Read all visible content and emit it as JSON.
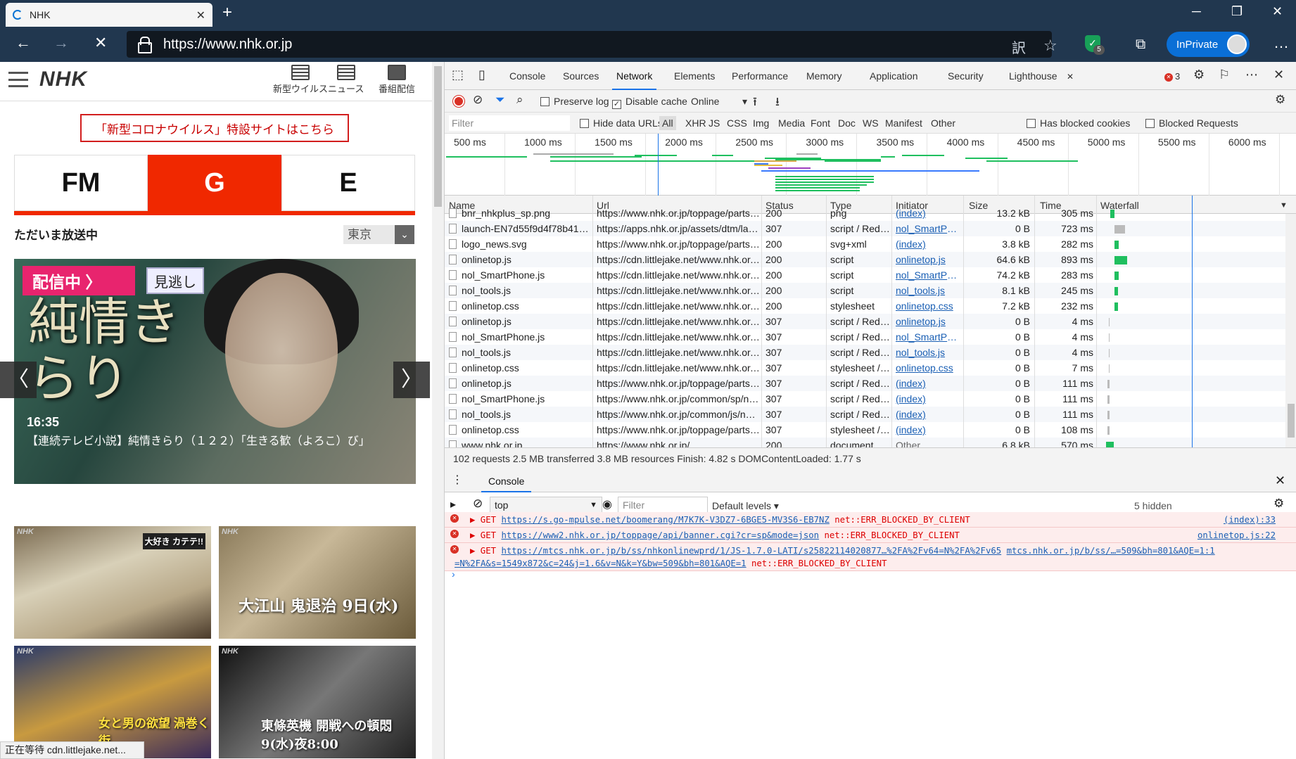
{
  "browser": {
    "tab_title": "NHK",
    "tab_close": "✕",
    "new_tab": "+",
    "url": "https://www.nhk.or.jp",
    "inprivate": "InPrivate",
    "shield_count": "5",
    "win_min": "─",
    "win_max": "❐",
    "win_close": "✕",
    "back": "←",
    "forward": "→",
    "stop": "✕",
    "more": "…",
    "translate": "訳",
    "fav": "☆",
    "collections": "⧉"
  },
  "page": {
    "logo": "NHK",
    "header_icons": [
      {
        "label": "新型ウイルス"
      },
      {
        "label": "ニュース"
      },
      {
        "label": "番組配信"
      }
    ],
    "banner": "「新型コロナウイルス」特設サイトはこちら",
    "channels": [
      "FM",
      "G",
      "E"
    ],
    "on_air": "ただいま放送中",
    "region": "東京",
    "region_dd": "⌄",
    "hero": {
      "live_badge": "配信中 〉",
      "rewatch": "見逃し",
      "title_art": "純情きらり",
      "time": "16:35",
      "desc": "【連続テレビ小説】純情きらり（１２２）「生きる歓（よろこ）び」",
      "prev": "〈",
      "next": "〉"
    },
    "thumbs": [
      {
        "brand": "NHK",
        "caption": "大好き カテテ!!"
      },
      {
        "brand": "NHK",
        "caption": "大江山 鬼退治 9日(水)"
      },
      {
        "brand": "NHK",
        "caption": "女と男の欲望 渦巻く街"
      },
      {
        "brand": "NHK",
        "caption": "東條英機 開戦への頓悶 9(水)夜8:00"
      }
    ],
    "status": "正在等待 cdn.littlejake.net..."
  },
  "devtools": {
    "tabs": [
      "Console",
      "Sources",
      "Network",
      "Elements",
      "Performance",
      "Memory",
      "Application",
      "Security",
      "Lighthouse"
    ],
    "active_tab": "Network",
    "lighthouse_close": "✕",
    "error_count": "3",
    "icons": {
      "inspect": "⬚",
      "device": "▯",
      "settings": "⚙",
      "feedback": "⚐",
      "more": "⋯",
      "close": "✕"
    },
    "toolbar": {
      "clear": "⊘",
      "filter": "⏷",
      "search": "⌕",
      "preserve_log": "Preserve log",
      "disable_cache": "Disable cache",
      "throttle": "Online",
      "throttle_dd": "▾",
      "import": "⭱",
      "export": "⭳",
      "settings": "⚙",
      "checkmark": "✓"
    },
    "filter": {
      "placeholder": "Filter",
      "hide_data_urls": "Hide data URLs",
      "types": [
        "All",
        "XHR",
        "JS",
        "CSS",
        "Img",
        "Media",
        "Font",
        "Doc",
        "WS",
        "Manifest",
        "Other"
      ],
      "has_blocked_cookies": "Has blocked cookies",
      "blocked_requests": "Blocked Requests"
    },
    "timeline_ticks": [
      "500 ms",
      "1000 ms",
      "1500 ms",
      "2000 ms",
      "2500 ms",
      "3000 ms",
      "3500 ms",
      "4000 ms",
      "4500 ms",
      "5000 ms",
      "5500 ms",
      "6000 ms"
    ],
    "columns": [
      "Name",
      "Url",
      "Status",
      "Type",
      "Initiator",
      "Size",
      "Time",
      "Waterfall"
    ],
    "waterfall_dd": "▼",
    "rows": [
      {
        "name": "bnr_nhkplus_sp.png",
        "url": "https://www.nhk.or.jp/toppage/parts/i...",
        "status": "200",
        "type": "png",
        "initiator": "(index)",
        "size": "13.2 kB",
        "time": "305 ms",
        "link": true
      },
      {
        "name": "launch-EN7d55f9d4f78b41259...",
        "url": "https://apps.nhk.or.jp/assets/dtm/launc...",
        "status": "307",
        "type": "script / Redir...",
        "initiator": "nol_SmartPho...",
        "size": "0 B",
        "time": "723 ms",
        "link": true
      },
      {
        "name": "logo_news.svg",
        "url": "https://www.nhk.or.jp/toppage/parts/i...",
        "status": "200",
        "type": "svg+xml",
        "initiator": "(index)",
        "size": "3.8 kB",
        "time": "282 ms",
        "link": true
      },
      {
        "name": "onlinetop.js",
        "url": "https://cdn.littlejake.net/www.nhk.or.jp/...",
        "status": "200",
        "type": "script",
        "initiator": "onlinetop.js",
        "size": "64.6 kB",
        "time": "893 ms",
        "link": true
      },
      {
        "name": "nol_SmartPhone.js",
        "url": "https://cdn.littlejake.net/www.nhk.or.jp/...",
        "status": "200",
        "type": "script",
        "initiator": "nol_SmartPho...",
        "size": "74.2 kB",
        "time": "283 ms",
        "link": true
      },
      {
        "name": "nol_tools.js",
        "url": "https://cdn.littlejake.net/www.nhk.or.jp/...",
        "status": "200",
        "type": "script",
        "initiator": "nol_tools.js",
        "size": "8.1 kB",
        "time": "245 ms",
        "link": true
      },
      {
        "name": "onlinetop.css",
        "url": "https://cdn.littlejake.net/www.nhk.or.jp/...",
        "status": "200",
        "type": "stylesheet",
        "initiator": "onlinetop.css",
        "size": "7.2 kB",
        "time": "232 ms",
        "link": true
      },
      {
        "name": "onlinetop.js",
        "url": "https://cdn.littlejake.net/www.nhk.or.jp/...",
        "status": "307",
        "type": "script / Redir...",
        "initiator": "onlinetop.js",
        "size": "0 B",
        "time": "4 ms",
        "link": true
      },
      {
        "name": "nol_SmartPhone.js",
        "url": "https://cdn.littlejake.net/www.nhk.or.jp/...",
        "status": "307",
        "type": "script / Redir...",
        "initiator": "nol_SmartPho...",
        "size": "0 B",
        "time": "4 ms",
        "link": true
      },
      {
        "name": "nol_tools.js",
        "url": "https://cdn.littlejake.net/www.nhk.or.jp/...",
        "status": "307",
        "type": "script / Redir...",
        "initiator": "nol_tools.js",
        "size": "0 B",
        "time": "4 ms",
        "link": true
      },
      {
        "name": "onlinetop.css",
        "url": "https://cdn.littlejake.net/www.nhk.or.jp/...",
        "status": "307",
        "type": "stylesheet / ...",
        "initiator": "onlinetop.css",
        "size": "0 B",
        "time": "7 ms",
        "link": true
      },
      {
        "name": "onlinetop.js",
        "url": "https://www.nhk.or.jp/toppage/parts/js...",
        "status": "307",
        "type": "script / Redir...",
        "initiator": "(index)",
        "size": "0 B",
        "time": "111 ms",
        "link": true
      },
      {
        "name": "nol_SmartPhone.js",
        "url": "https://www.nhk.or.jp/common/sp/nol_...",
        "status": "307",
        "type": "script / Redir...",
        "initiator": "(index)",
        "size": "0 B",
        "time": "111 ms",
        "link": true
      },
      {
        "name": "nol_tools.js",
        "url": "https://www.nhk.or.jp/common/js/nol_t...",
        "status": "307",
        "type": "script / Redir...",
        "initiator": "(index)",
        "size": "0 B",
        "time": "111 ms",
        "link": true
      },
      {
        "name": "onlinetop.css",
        "url": "https://www.nhk.or.jp/toppage/parts/cs...",
        "status": "307",
        "type": "stylesheet / ...",
        "initiator": "(index)",
        "size": "0 B",
        "time": "108 ms",
        "link": true
      },
      {
        "name": "www.nhk.or.jp",
        "url": "https://www.nhk.or.jp/",
        "status": "200",
        "type": "document",
        "initiator": "Other",
        "size": "6.8 kB",
        "time": "570 ms",
        "link": false
      }
    ],
    "summary": "102 requests  2.5 MB transferred  3.8 MB resources  Finish: 4.82 s  DOMContentLoaded: 1.77 s",
    "drawer": {
      "more": "⋮",
      "tab": "Console",
      "close": "✕",
      "context": "top",
      "context_dd": "▼",
      "filter_placeholder": "Filter",
      "levels": "Default levels ▾",
      "hidden": "5 hidden",
      "prompt": "›",
      "sidebar": "▸",
      "clear": "⊘",
      "eye": "◉",
      "settings": "⚙",
      "err_icon": "✕",
      "logs": [
        {
          "method": "▶ GET",
          "url": "https://s.go-mpulse.net/boomerang/M7K7K-V3DZ7-6BGE5-MV3S6-EB7NZ",
          "err": "net::ERR_BLOCKED_BY_CLIENT",
          "src": "(index):33"
        },
        {
          "method": "▶ GET",
          "url": "https://www2.nhk.or.jp/toppage/api/banner.cgi?cr=sp&mode=json",
          "err": "net::ERR_BLOCKED_BY_CLIENT",
          "src": "onlinetop.js:22"
        },
        {
          "method": "▶ GET",
          "url": "https://mtcs.nhk.or.jp/b/ss/nhkonlinewprd/1/JS-1.7.0-LATI/s25822114020877…%2FA%2Fv64=N%2FA%2Fv65",
          "url2": "mtcs.nhk.or.jp/b/ss/…=509&bh=801&AQE=1:1",
          "url3": "=N%2FA&s=1549x872&c=24&j=1.6&v=N&k=Y&bw=509&bh=801&AQE=1",
          "err": "net::ERR_BLOCKED_BY_CLIENT"
        }
      ]
    }
  }
}
